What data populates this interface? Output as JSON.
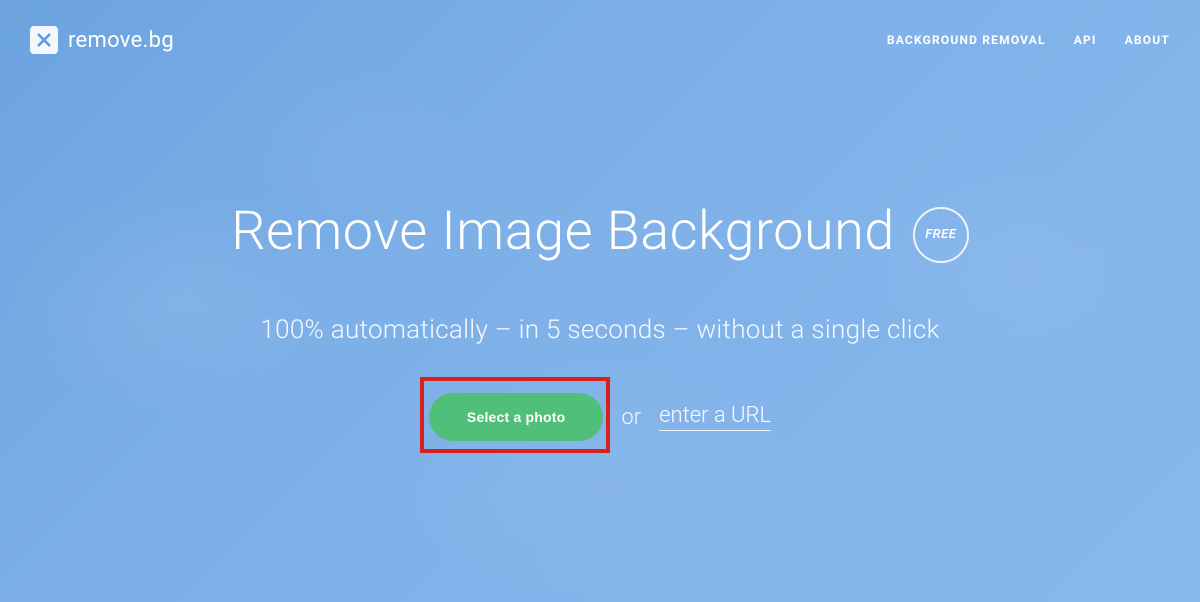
{
  "header": {
    "logo_text": "remove.bg",
    "nav": {
      "bg_removal": "BACKGROUND REMOVAL",
      "api": "API",
      "about": "ABOUT"
    }
  },
  "hero": {
    "title": "Remove Image Background",
    "badge": "FREE",
    "subtitle": "100% automatically – in 5 seconds – without a single click",
    "cta": {
      "select_label": "Select a photo",
      "or_text": "or",
      "url_link": "enter a URL"
    }
  },
  "colors": {
    "accent_green": "#4fbf7a",
    "highlight_red": "#d92020",
    "bg_blue": "#7eb0e8"
  }
}
